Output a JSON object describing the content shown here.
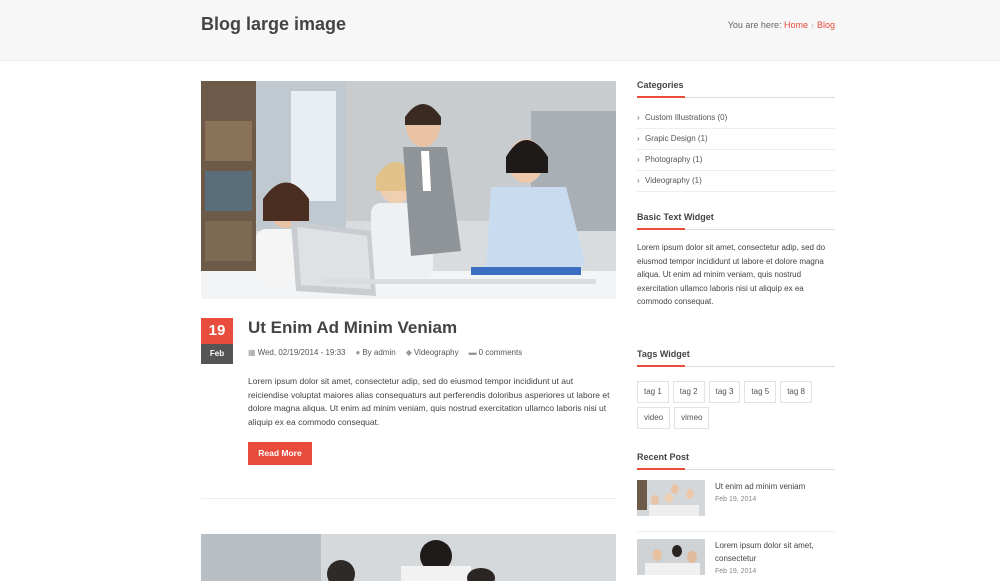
{
  "header": {
    "title": "Blog large image",
    "breadcrumb_prefix": "You are here:",
    "breadcrumb_home": "Home",
    "breadcrumb_current": "Blog"
  },
  "post": {
    "day": "19",
    "month": "Feb",
    "title": "Ut Enim Ad Minim Veniam",
    "date": "Wed, 02/19/2014 - 19:33",
    "author": "By admin",
    "category": "Videography",
    "comments": "0 comments",
    "excerpt": "Lorem ipsum dolor sit amet, consectetur adip, sed do eiusmod tempor incididunt ut aut reiciendise voluptat maiores alias consequaturs aut perferendis doloribus asperiores ut labore et dolore magna aliqua. Ut enim ad minim veniam, quis nostrud exercitation ullamco laboris nisi ut aliquip ex ea commodo consequat.",
    "read_more": "Read More"
  },
  "sidebar": {
    "categories_title": "Categories",
    "categories": [
      {
        "label": "Custom Illustrations (0)"
      },
      {
        "label": "Grapic Design (1)"
      },
      {
        "label": "Photography (1)"
      },
      {
        "label": "Videography (1)"
      }
    ],
    "text_widget_title": "Basic Text Widget",
    "text_widget_body": "Lorem ipsum dolor sit amet, consectetur adip, sed do eiusmod tempor incididunt ut labore et dolore magna aliqua. Ut enim ad minim veniam, quis nostrud exercitation ullamco laboris nisi ut aliquip ex ea commodo consequat.",
    "tags_title": "Tags Widget",
    "tags": [
      "tag 1",
      "tag 2",
      "tag 3",
      "tag 5",
      "tag 8",
      "video",
      "vimeo"
    ],
    "recent_title": "Recent Post",
    "recent": [
      {
        "title": "Ut enim ad minim veniam",
        "date": "Feb 19, 2014"
      },
      {
        "title": "Lorem ipsum dolor sit amet, consectetur",
        "date": "Feb 19, 2014"
      }
    ]
  },
  "colors": {
    "accent": "#e74c3c",
    "header_bg": "#f7f7f7",
    "month_bg": "#555555"
  },
  "icons": {
    "calendar": "calendar-icon",
    "user": "user-icon",
    "tag": "tag-icon",
    "comment": "comment-icon",
    "chevron": "chevron-right-icon"
  }
}
